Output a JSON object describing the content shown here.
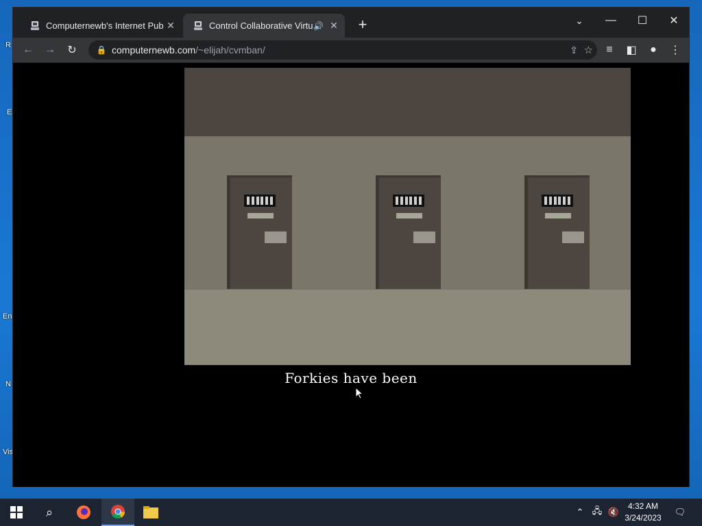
{
  "desktop": {
    "labels": [
      "R",
      "E",
      "En",
      "N",
      "Vis"
    ]
  },
  "browser": {
    "tabs": [
      {
        "title": "Computernewb's Internet Pub Hu",
        "icon": "site-favicon",
        "active": false
      },
      {
        "title": "Control Collaborative Virtual",
        "icon": "site-favicon",
        "active": true,
        "audio": "🔊"
      }
    ],
    "new_tab": "+",
    "url_host": "computernewb.com",
    "url_path": "/~elijah/cvmban/",
    "window_controls": {
      "minimize": "—",
      "maximize": "☐",
      "close": "✕",
      "tab_search": "⌄"
    }
  },
  "page": {
    "caption": "Forkies have been"
  },
  "taskbar": {
    "time": "4:32 AM",
    "date": "3/24/2023",
    "apps": [
      "start",
      "search",
      "firefox",
      "chrome",
      "file-explorer"
    ]
  }
}
